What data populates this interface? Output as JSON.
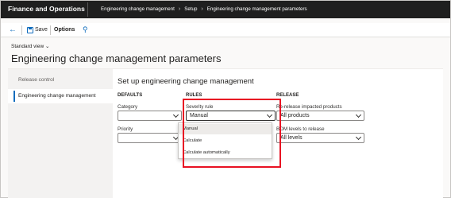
{
  "topbar": {
    "app_title": "Finance and Operations",
    "breadcrumb": [
      "Engineering change management",
      "Setup",
      "Engineering change management parameters"
    ]
  },
  "actionpane": {
    "save_label": "Save",
    "options_label": "Options"
  },
  "view": {
    "label": "Standard view ⌄"
  },
  "page": {
    "title": "Engineering change management parameters"
  },
  "nav": {
    "items": [
      {
        "label": "Release control"
      },
      {
        "label": "Engineering change management"
      }
    ]
  },
  "section": {
    "title": "Set up engineering change management"
  },
  "groups": {
    "defaults": {
      "heading": "DEFAULTS",
      "category_label": "Category",
      "category_value": "",
      "priority_label": "Priority",
      "priority_value": ""
    },
    "rules": {
      "heading": "RULES",
      "severity_label": "Severity rule",
      "severity_value": "Manual"
    },
    "release": {
      "heading": "RELEASE",
      "rerelease_label": "Re-release impacted products",
      "rerelease_value": "All products",
      "bom_label": "BOM levels to release",
      "bom_value": "All levels"
    }
  },
  "severity_dropdown": {
    "options": [
      "Manual",
      "Calculate",
      "Calculate automatically"
    ],
    "selected": "Manual"
  },
  "colors": {
    "topbar": "#1f1f1f",
    "accent": "#0f6cbd",
    "highlight": "#e81123"
  }
}
